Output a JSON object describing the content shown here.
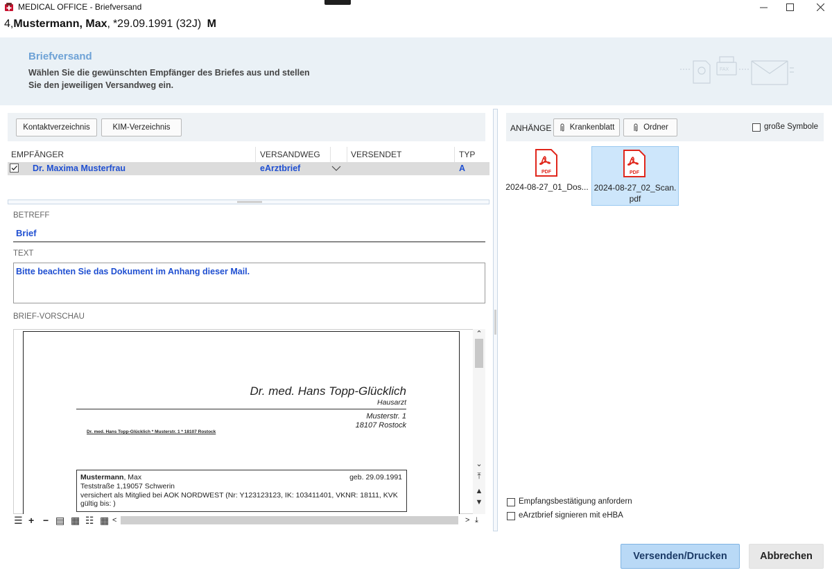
{
  "window": {
    "title": "MEDICAL OFFICE - Briefversand"
  },
  "patient": {
    "number": "4,",
    "name": "Mustermann, Max",
    "separator": ",",
    "birth": "*29.09.1991 (32J)",
    "sex": "M"
  },
  "header": {
    "title": "Briefversand",
    "description": "Wählen Sie die gewünschten Empfänger des Briefes aus und stellen Sie den jeweiligen Versandweg ein.",
    "illustration_labels": {
      "fax": "FAX"
    }
  },
  "toolbar_left": {
    "contacts_button": "Kontaktverzeichnis",
    "kim_button": "KIM-Verzeichnis"
  },
  "recipients": {
    "columns": [
      "EMPFÄNGER",
      "VERSANDWEG",
      "VERSENDET",
      "TYP"
    ],
    "rows": [
      {
        "checked": true,
        "recipient": "Dr. Maxima Musterfrau",
        "method": "eArztbrief",
        "sent": "",
        "type": "A"
      }
    ]
  },
  "subject": {
    "label": "BETREFF",
    "value": "Brief"
  },
  "text": {
    "label": "TEXT",
    "value": "Bitte beachten Sie das Dokument im Anhang dieser Mail."
  },
  "preview": {
    "label": "BRIEF-VORSCHAU",
    "doctor_name": "Dr. med. Hans Topp-Glücklich",
    "doctor_role": "Hausarzt",
    "street": "Musterstr. 1",
    "city": "18107 Rostock",
    "return_address": "Dr. med. Hans Topp-Glücklich * Musterstr. 1 * 18107 Rostock",
    "addressee_last": "Mustermann",
    "addressee_first": ", Max",
    "addressee_birth": "geb. 29.09.1991",
    "addressee_street": "Teststraße 1,19057 Schwerin",
    "addressee_insurance": "versichert als Mitglied bei AOK NORDWEST (Nr: Y123123123, IK: 103411401, VKNR: 18111, KVK",
    "addressee_valid": "gültig bis: )"
  },
  "attachments": {
    "label": "ANHÄNGE",
    "chart_button": "Krankenblatt",
    "folder_button": "Ordner",
    "large_icons_label": "große Symbole",
    "large_icons_checked": false,
    "files": [
      {
        "name": "2024-08-27_01_Dos...",
        "icon_label": "PDF",
        "selected": false
      },
      {
        "name": "2024-08-27_02_Scan.\npdf",
        "icon_label": "PDF",
        "selected": true
      }
    ]
  },
  "options": {
    "receipt_label": "Empfangsbestätigung anfordern",
    "receipt_checked": false,
    "sign_label": "eArztbrief signieren mit eHBA",
    "sign_checked": false
  },
  "actions": {
    "send": "Versenden/Drucken",
    "cancel": "Abbrechen"
  },
  "colors": {
    "accent_text": "#1f4fd1",
    "header_title": "#6ea2d6",
    "header_band": "#eaf1f6",
    "primary_button": "#b9d9f6",
    "pdf_red": "#e0261b"
  }
}
